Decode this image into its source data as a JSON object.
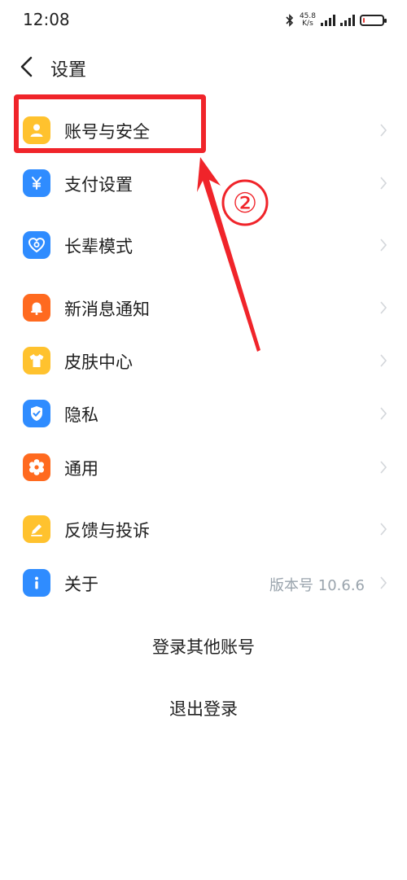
{
  "status_bar": {
    "time": "12:08",
    "net_speed_value": "45.8",
    "net_speed_unit": "K/s",
    "battery_level": 0.08
  },
  "header": {
    "title": "设置"
  },
  "settings": {
    "items": [
      {
        "label": "账号与安全",
        "icon": "user-icon",
        "color": "#ffc22e"
      },
      {
        "label": "支付设置",
        "icon": "yen-icon",
        "color": "#2f8cff"
      },
      {
        "label": "长辈模式",
        "icon": "heart-icon",
        "color": "#2f8cff"
      },
      {
        "label": "新消息通知",
        "icon": "bell-icon",
        "color": "#ff6a1f"
      },
      {
        "label": "皮肤中心",
        "icon": "shirt-icon",
        "color": "#ffc22e"
      },
      {
        "label": "隐私",
        "icon": "shield-icon",
        "color": "#2f8cff"
      },
      {
        "label": "通用",
        "icon": "gear-icon",
        "color": "#ff6a1f"
      },
      {
        "label": "反馈与投诉",
        "icon": "pencil-icon",
        "color": "#ffc22e"
      },
      {
        "label": "关于",
        "icon": "info-icon",
        "color": "#2f8cff",
        "value": "版本号 10.6.6"
      }
    ]
  },
  "actions": {
    "switch_account": "登录其他账号",
    "logout": "退出登录"
  },
  "annotation": {
    "step": "②",
    "color": "#f0242a"
  }
}
